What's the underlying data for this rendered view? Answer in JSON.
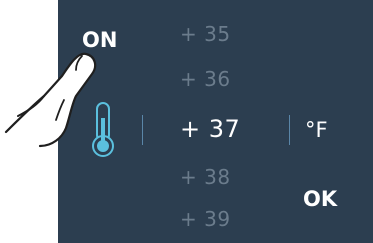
{
  "power_button": {
    "label": "ON"
  },
  "temperatures": [
    {
      "label": "+ 35",
      "selected": false
    },
    {
      "label": "+ 36",
      "selected": false
    },
    {
      "label": "+ 37",
      "selected": true
    },
    {
      "label": "+ 38",
      "selected": false
    },
    {
      "label": "+ 39",
      "selected": false
    }
  ],
  "unit_toggle": {
    "label": "°F"
  },
  "confirm_button": {
    "label": "OK"
  },
  "icons": {
    "thermometer": "thermometer-icon",
    "pointer": "finger-pointer-icon"
  },
  "colors": {
    "panel": "#2c3e50",
    "text_active": "#ffffff",
    "text_inactive": "#6b7c8c",
    "accent": "#5bc0de"
  }
}
